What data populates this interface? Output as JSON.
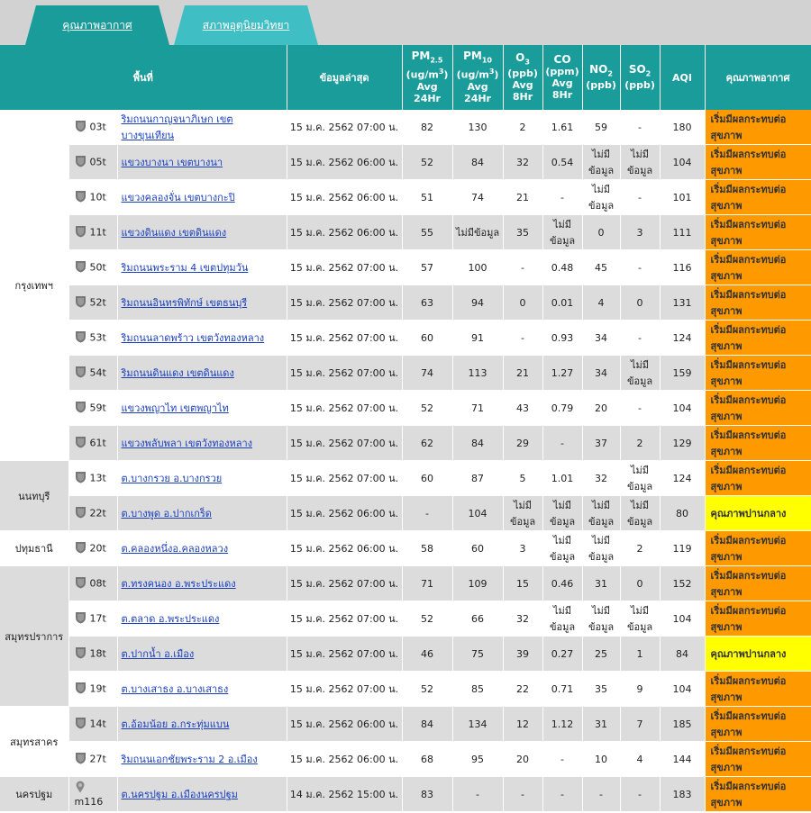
{
  "tabs": [
    {
      "label": "คุณภาพอากาศ",
      "active": true
    },
    {
      "label": "สภาพอุตุนิยมวิทยา",
      "active": false
    }
  ],
  "columns": {
    "area": "พื้นที่",
    "latest": "ข้อมูลล่าสุด",
    "pm25": {
      "main": "PM",
      "sub": "2.5",
      "unit": "(ug/m",
      "unit_sup": "3",
      "unit_end": ")",
      "avg": "Avg",
      "hr": "24Hr"
    },
    "pm10": {
      "main": "PM",
      "sub": "10",
      "unit": "(ug/m",
      "unit_sup": "3",
      "unit_end": ")",
      "avg": "Avg",
      "hr": "24Hr"
    },
    "o3": {
      "main": "O",
      "sub": "3",
      "unit": "(ppb)",
      "avg": "Avg",
      "hr": "8Hr"
    },
    "co": {
      "main": "CO",
      "unit": "(ppm)",
      "avg": "Avg",
      "hr": "8Hr"
    },
    "no2": {
      "main": "NO",
      "sub": "2",
      "unit": "(ppb)"
    },
    "so2": {
      "main": "SO",
      "sub": "2",
      "unit": "(ppb)"
    },
    "aqi": "AQI",
    "quality": "คุณภาพอากาศ"
  },
  "colors": {
    "header": "#1a9c9b",
    "tab_active": "#1a9c9b",
    "tab_inactive": "#3fbfc3",
    "orange": "#ff9900",
    "yellow": "#ffff00",
    "link": "#1a3fbd"
  },
  "provinces": [
    {
      "name": "กรุงเทพฯ",
      "rows": 10
    },
    {
      "name": "นนทบุรี",
      "rows": 2
    },
    {
      "name": "ปทุมธานี",
      "rows": 1
    },
    {
      "name": "สมุทรปราการ",
      "rows": 4
    },
    {
      "name": "สมุทรสาคร",
      "rows": 2
    },
    {
      "name": "นครปฐม",
      "rows": 1
    }
  ],
  "rows": [
    {
      "id": "03t",
      "name": "ริมถนนกาญจนาภิเษก เขตบางขุนเทียน",
      "time": "15 ม.ค. 2562 07:00 น.",
      "pm25": "82",
      "pm10": "130",
      "o3": "2",
      "co": "1.61",
      "no2": "59",
      "so2": "-",
      "aqi": "180",
      "quality": "เริ่มมีผลกระทบต่อสุขภาพ",
      "level": "orange"
    },
    {
      "id": "05t",
      "name": "แขวงบางนา เขตบางนา",
      "time": "15 ม.ค. 2562 06:00 น.",
      "pm25": "52",
      "pm10": "84",
      "o3": "32",
      "co": "0.54",
      "no2": "ไม่มีข้อมูล",
      "so2": "ไม่มีข้อมูล",
      "aqi": "104",
      "quality": "เริ่มมีผลกระทบต่อสุขภาพ",
      "level": "orange"
    },
    {
      "id": "10t",
      "name": "แขวงคลองจั่น เขตบางกะปิ",
      "time": "15 ม.ค. 2562 06:00 น.",
      "pm25": "51",
      "pm10": "74",
      "o3": "21",
      "co": "-",
      "no2": "ไม่มีข้อมูล",
      "so2": "-",
      "aqi": "101",
      "quality": "เริ่มมีผลกระทบต่อสุขภาพ",
      "level": "orange"
    },
    {
      "id": "11t",
      "name": "แขวงดินแดง เขตดินแดง",
      "time": "15 ม.ค. 2562 06:00 น.",
      "pm25": "55",
      "pm10": "ไม่มีข้อมูล",
      "o3": "35",
      "co": "ไม่มีข้อมูล",
      "no2": "0",
      "so2": "3",
      "aqi": "111",
      "quality": "เริ่มมีผลกระทบต่อสุขภาพ",
      "level": "orange"
    },
    {
      "id": "50t",
      "name": "ริมถนนพระราม 4 เขตปทุมวัน",
      "time": "15 ม.ค. 2562 07:00 น.",
      "pm25": "57",
      "pm10": "100",
      "o3": "-",
      "co": "0.48",
      "no2": "45",
      "so2": "-",
      "aqi": "116",
      "quality": "เริ่มมีผลกระทบต่อสุขภาพ",
      "level": "orange"
    },
    {
      "id": "52t",
      "name": "ริมถนนอินทรพิทักษ์ เขตธนบุรี",
      "time": "15 ม.ค. 2562 07:00 น.",
      "pm25": "63",
      "pm10": "94",
      "o3": "0",
      "co": "0.01",
      "no2": "4",
      "so2": "0",
      "aqi": "131",
      "quality": "เริ่มมีผลกระทบต่อสุขภาพ",
      "level": "orange"
    },
    {
      "id": "53t",
      "name": "ริมถนนลาดพร้าว เขตวังทองหลาง",
      "time": "15 ม.ค. 2562 07:00 น.",
      "pm25": "60",
      "pm10": "91",
      "o3": "-",
      "co": "0.93",
      "no2": "34",
      "so2": "-",
      "aqi": "124",
      "quality": "เริ่มมีผลกระทบต่อสุขภาพ",
      "level": "orange"
    },
    {
      "id": "54t",
      "name": "ริมถนนดินแดง เขตดินแดง",
      "time": "15 ม.ค. 2562 07:00 น.",
      "pm25": "74",
      "pm10": "113",
      "o3": "21",
      "co": "1.27",
      "no2": "34",
      "so2": "ไม่มีข้อมูล",
      "aqi": "159",
      "quality": "เริ่มมีผลกระทบต่อสุขภาพ",
      "level": "orange"
    },
    {
      "id": "59t",
      "name": "แขวงพญาไท เขตพญาไท",
      "time": "15 ม.ค. 2562 07:00 น.",
      "pm25": "52",
      "pm10": "71",
      "o3": "43",
      "co": "0.79",
      "no2": "20",
      "so2": "-",
      "aqi": "104",
      "quality": "เริ่มมีผลกระทบต่อสุขภาพ",
      "level": "orange"
    },
    {
      "id": "61t",
      "name": "แขวงพลับพลา เขตวังทองหลาง",
      "time": "15 ม.ค. 2562 07:00 น.",
      "pm25": "62",
      "pm10": "84",
      "o3": "29",
      "co": "-",
      "no2": "37",
      "so2": "2",
      "aqi": "129",
      "quality": "เริ่มมีผลกระทบต่อสุขภาพ",
      "level": "orange"
    },
    {
      "id": "13t",
      "name": "ต.บางกรวย อ.บางกรวย",
      "time": "15 ม.ค. 2562 07:00 น.",
      "pm25": "60",
      "pm10": "87",
      "o3": "5",
      "co": "1.01",
      "no2": "32",
      "so2": "ไม่มีข้อมูล",
      "aqi": "124",
      "quality": "เริ่มมีผลกระทบต่อสุขภาพ",
      "level": "orange"
    },
    {
      "id": "22t",
      "name": "ต.บางพูด อ.ปากเกร็ด",
      "time": "15 ม.ค. 2562 06:00 น.",
      "pm25": "-",
      "pm10": "104",
      "o3": "ไม่มีข้อมูล",
      "co": "ไม่มีข้อมูล",
      "no2": "ไม่มีข้อมูล",
      "so2": "ไม่มีข้อมูล",
      "aqi": "80",
      "quality": "คุณภาพปานกลาง",
      "level": "yellow"
    },
    {
      "id": "20t",
      "name": "ต.คลองหนึ่งอ.คลองหลวง",
      "time": "15 ม.ค. 2562 06:00 น.",
      "pm25": "58",
      "pm10": "60",
      "o3": "3",
      "co": "ไม่มีข้อมูล",
      "no2": "ไม่มีข้อมูล",
      "so2": "2",
      "aqi": "119",
      "quality": "เริ่มมีผลกระทบต่อสุขภาพ",
      "level": "orange"
    },
    {
      "id": "08t",
      "name": "ต.ทรงคนอง อ.พระประแดง",
      "time": "15 ม.ค. 2562 07:00 น.",
      "pm25": "71",
      "pm10": "109",
      "o3": "15",
      "co": "0.46",
      "no2": "31",
      "so2": "0",
      "aqi": "152",
      "quality": "เริ่มมีผลกระทบต่อสุขภาพ",
      "level": "orange"
    },
    {
      "id": "17t",
      "name": "ต.ตลาด อ.พระประแดง",
      "time": "15 ม.ค. 2562 07:00 น.",
      "pm25": "52",
      "pm10": "66",
      "o3": "32",
      "co": "ไม่มีข้อมูล",
      "no2": "ไม่มีข้อมูล",
      "so2": "ไม่มีข้อมูล",
      "aqi": "104",
      "quality": "เริ่มมีผลกระทบต่อสุขภาพ",
      "level": "orange"
    },
    {
      "id": "18t",
      "name": "ต.ปากน้ำ อ.เมือง",
      "time": "15 ม.ค. 2562 07:00 น.",
      "pm25": "46",
      "pm10": "75",
      "o3": "39",
      "co": "0.27",
      "no2": "25",
      "so2": "1",
      "aqi": "84",
      "quality": "คุณภาพปานกลาง",
      "level": "yellow"
    },
    {
      "id": "19t",
      "name": "ต.บางเสาธง อ.บางเสาธง",
      "time": "15 ม.ค. 2562 07:00 น.",
      "pm25": "52",
      "pm10": "85",
      "o3": "22",
      "co": "0.71",
      "no2": "35",
      "so2": "9",
      "aqi": "104",
      "quality": "เริ่มมีผลกระทบต่อสุขภาพ",
      "level": "orange"
    },
    {
      "id": "14t",
      "name": "ต.อ้อมน้อย อ.กระทุ่มแบน",
      "time": "15 ม.ค. 2562 06:00 น.",
      "pm25": "84",
      "pm10": "134",
      "o3": "12",
      "co": "1.12",
      "no2": "31",
      "so2": "7",
      "aqi": "185",
      "quality": "เริ่มมีผลกระทบต่อสุขภาพ",
      "level": "orange"
    },
    {
      "id": "27t",
      "name": "ริมถนนเอกชัยพระราม 2 อ.เมือง",
      "time": "15 ม.ค. 2562 06:00 น.",
      "pm25": "68",
      "pm10": "95",
      "o3": "20",
      "co": "-",
      "no2": "10",
      "so2": "4",
      "aqi": "144",
      "quality": "เริ่มมีผลกระทบต่อสุขภาพ",
      "level": "orange"
    },
    {
      "id": "m116",
      "name": "ต.นครปฐม อ.เมืองนครปฐม",
      "time": "14 ม.ค. 2562 15:00 น.",
      "pm25": "83",
      "pm10": "-",
      "o3": "-",
      "co": "-",
      "no2": "-",
      "so2": "-",
      "aqi": "183",
      "quality": "เริ่มมีผลกระทบต่อสุขภาพ",
      "level": "orange",
      "icon": "pin"
    }
  ]
}
